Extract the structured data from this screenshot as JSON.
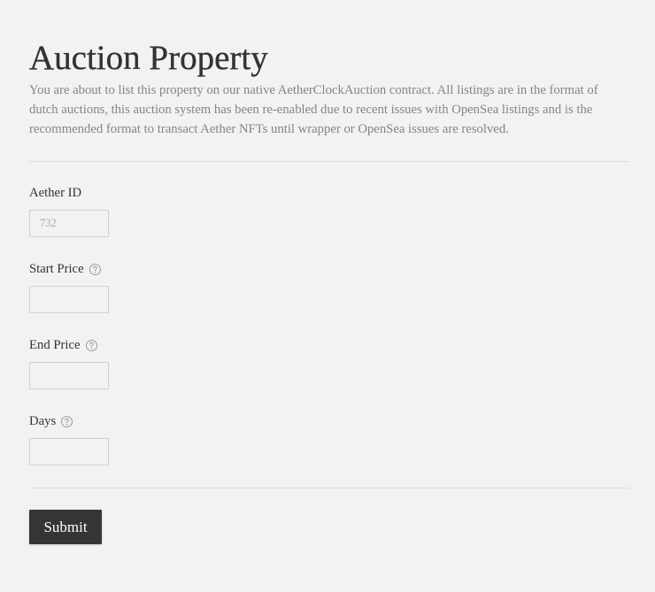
{
  "page": {
    "title": "Auction Property",
    "description": "You are about to list this property on our native AetherClockAuction contract. All listings are in the format of dutch auctions, this auction system has been re-enabled due to recent issues with OpenSea listings and is the recommended format to transact Aether NFTs until wrapper or OpenSea issues are resolved."
  },
  "form": {
    "fields": [
      {
        "label": "Aether ID",
        "placeholder": "732"
      },
      {
        "label": "Start Price",
        "help_icon": "question-circle-icon"
      },
      {
        "label": "End Price",
        "help_icon": "question-circle-icon"
      },
      {
        "label": "Days",
        "help_icon": "question-circle-icon"
      }
    ],
    "submit_label": "Submit"
  },
  "colors": {
    "background": "#f2f2f2",
    "text": "#333333",
    "muted": "#858585",
    "divider": "#dedede",
    "input_border": "#d0d0d0",
    "placeholder": "#a8a8a8",
    "icon": "#9a9a9a",
    "button": "#353535",
    "button_text": "#ffffff"
  }
}
